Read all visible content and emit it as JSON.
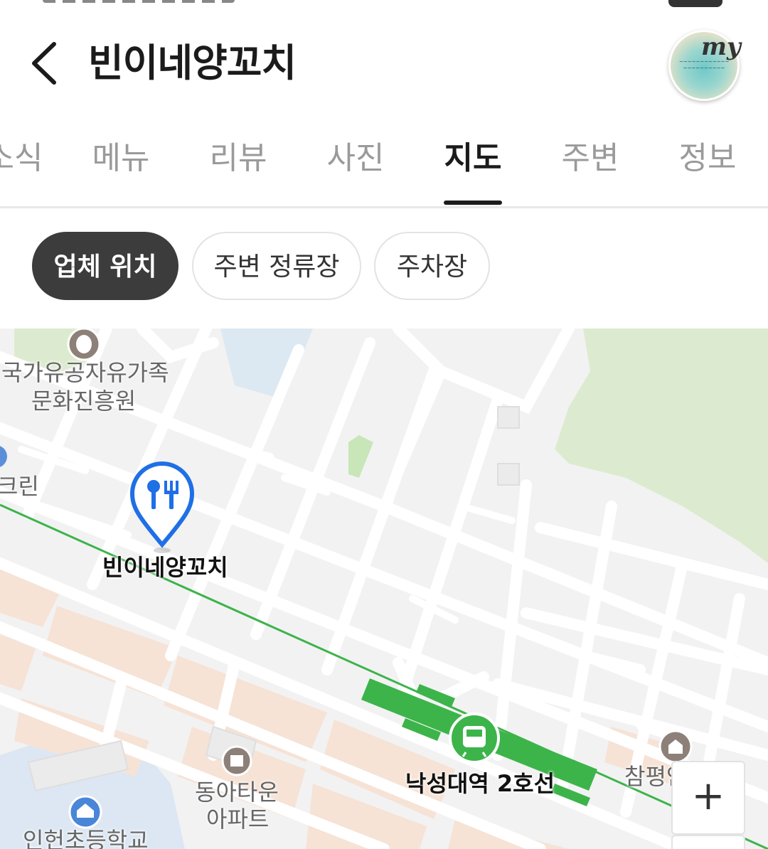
{
  "header": {
    "title": "빈이네양꼬치",
    "my_label": "my"
  },
  "tabs": [
    {
      "label": "소식",
      "active": false
    },
    {
      "label": "메뉴",
      "active": false
    },
    {
      "label": "리뷰",
      "active": false
    },
    {
      "label": "사진",
      "active": false
    },
    {
      "label": "지도",
      "active": true
    },
    {
      "label": "주변",
      "active": false
    },
    {
      "label": "정보",
      "active": false
    }
  ],
  "filters": [
    {
      "label": "업체 위치",
      "active": true
    },
    {
      "label": "주변 정류장",
      "active": false
    },
    {
      "label": "주차장",
      "active": false
    }
  ],
  "map": {
    "labels": {
      "poi1_line1": "국가유공자유가족",
      "poi1_line2": "문화진흥원",
      "left_cut": "크린",
      "store": "빈이네양꼬치",
      "station": "낙성대역 2호선",
      "church": "참평안교회",
      "apt_line1": "동아타운",
      "apt_line2": "아파트",
      "school": "인헌초등학교"
    },
    "zoom_in": "+",
    "colors": {
      "subway_line2": "#3cb44a",
      "marker": "#1f6fe5",
      "park": "#dcebcf"
    }
  }
}
